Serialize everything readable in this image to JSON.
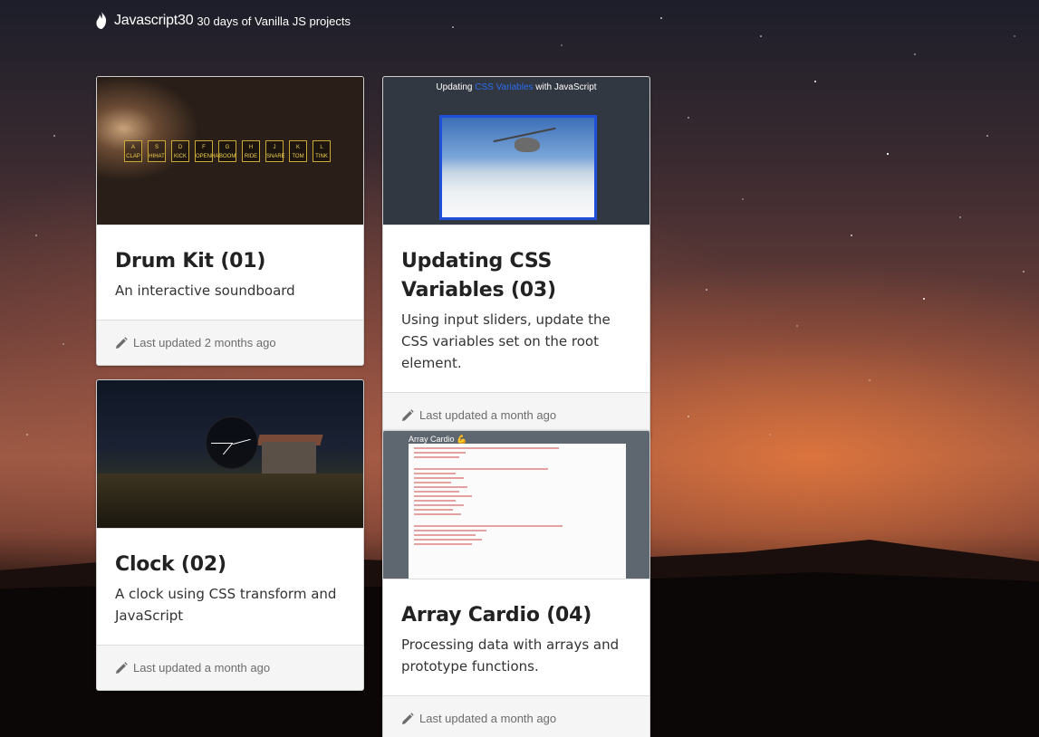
{
  "header": {
    "brand": "Javascript30",
    "tagline": "30 days of Vanilla JS projects",
    "icon": "flame-icon"
  },
  "cards": [
    {
      "title": "Drum Kit (01)",
      "description": "An interactive soundboard",
      "updated": "Last updated 2 months ago",
      "thumb_keys": [
        {
          "key": "A",
          "sound": "CLAP"
        },
        {
          "key": "S",
          "sound": "HIHAT"
        },
        {
          "key": "D",
          "sound": "KICK"
        },
        {
          "key": "F",
          "sound": "OPENHAT"
        },
        {
          "key": "G",
          "sound": "BOOM"
        },
        {
          "key": "H",
          "sound": "RIDE"
        },
        {
          "key": "J",
          "sound": "SNARE"
        },
        {
          "key": "K",
          "sound": "TOM"
        },
        {
          "key": "L",
          "sound": "TINK"
        }
      ]
    },
    {
      "title": "Updating CSS Variables (03)",
      "description": "Using input sliders, update the CSS variables set on the root element.",
      "updated": "Last updated a month ago",
      "thumb_title_pre": "Updating ",
      "thumb_title_hl": "CSS Variables",
      "thumb_title_post": " with JavaScript"
    },
    {
      "title": "Clock (02)",
      "description": "A clock using CSS transform and JavaScript",
      "updated": "Last updated a month ago"
    },
    {
      "title": "Array Cardio (04)",
      "description": "Processing data with arrays and prototype functions.",
      "updated": "Last updated a month ago",
      "thumb_title": "Array Cardio 💪"
    }
  ],
  "colors": {
    "card_bg": "#ffffff",
    "footer_bg": "#f5f5f5",
    "title_text": "#222222",
    "muted_text": "#6c6c6c",
    "accent_blue": "#1f4fd8"
  }
}
